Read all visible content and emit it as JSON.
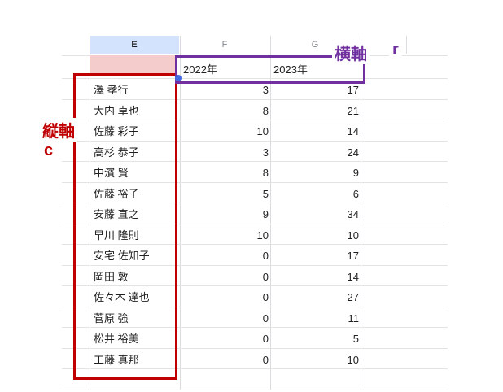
{
  "column_headers": {
    "e": "E",
    "f": "F",
    "g": "G"
  },
  "header_row": {
    "year_2022": "2022年",
    "year_2023": "2023年"
  },
  "rows": [
    {
      "name": "澤 孝行",
      "v2022": "3",
      "v2023": "17"
    },
    {
      "name": "大内 卓也",
      "v2022": "8",
      "v2023": "21"
    },
    {
      "name": "佐藤 彩子",
      "v2022": "10",
      "v2023": "14"
    },
    {
      "name": "高杉 恭子",
      "v2022": "3",
      "v2023": "24"
    },
    {
      "name": "中濱 賢",
      "v2022": "8",
      "v2023": "9"
    },
    {
      "name": "佐藤 裕子",
      "v2022": "5",
      "v2023": "6"
    },
    {
      "name": "安藤 直之",
      "v2022": "9",
      "v2023": "34"
    },
    {
      "name": "早川 隆則",
      "v2022": "10",
      "v2023": "10"
    },
    {
      "name": "安宅 佐知子",
      "v2022": "0",
      "v2023": "17"
    },
    {
      "name": "岡田 敦",
      "v2022": "0",
      "v2023": "14"
    },
    {
      "name": "佐々木 達也",
      "v2022": "0",
      "v2023": "27"
    },
    {
      "name": "菅原 強",
      "v2022": "0",
      "v2023": "11"
    },
    {
      "name": "松井 裕美",
      "v2022": "0",
      "v2023": "5"
    },
    {
      "name": "工藤 真那",
      "v2022": "0",
      "v2023": "10"
    }
  ],
  "annotations": {
    "vertical_axis_label": "縦軸",
    "vertical_axis_var": "c",
    "horizontal_axis_label": "横軸",
    "horizontal_axis_var": "r"
  },
  "colors": {
    "vertical_annotation": "#c00000",
    "horizontal_annotation": "#7030a0",
    "selected_cell_fill": "#f4cccc",
    "selected_column_header": "#d3e3fd"
  }
}
